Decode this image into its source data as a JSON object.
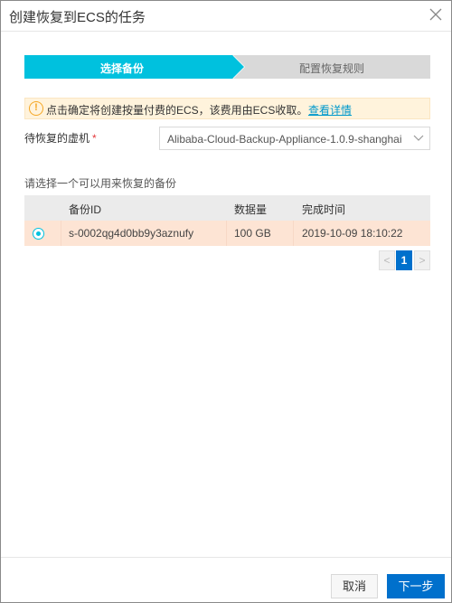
{
  "dialog": {
    "title": "创建恢复到ECS的任务",
    "close_icon": "close-icon"
  },
  "steps": [
    {
      "label": "选择备份",
      "active": true
    },
    {
      "label": "配置恢复规则",
      "active": false
    }
  ],
  "alert": {
    "icon": "warning-icon",
    "text": "点击确定将创建按量付费的ECS，该费用由ECS收取。",
    "link": "查看详情"
  },
  "vm_field": {
    "label": "待恢复的虚机",
    "required_mark": "*",
    "value": "Alibaba-Cloud-Backup-Appliance-1.0.9-shanghai"
  },
  "backup_table": {
    "label": "请选择一个可以用来恢复的备份",
    "columns": [
      "",
      "备份ID",
      "数据量",
      "完成时间"
    ],
    "rows": [
      {
        "selected": true,
        "backup_id": "s-0002qg4d0bb9y3aznufy",
        "size": "100 GB",
        "finished": "2019-10-09 18:10:22"
      }
    ]
  },
  "pagination": {
    "prev": "<",
    "current": "1",
    "next": ">"
  },
  "footer": {
    "cancel_label": "取消",
    "next_label": "下一步"
  },
  "colors": {
    "active_step": "#00c1de",
    "primary": "#0070cc",
    "selected_row": "#fde4d4",
    "alert_bg": "#fff3dc"
  }
}
